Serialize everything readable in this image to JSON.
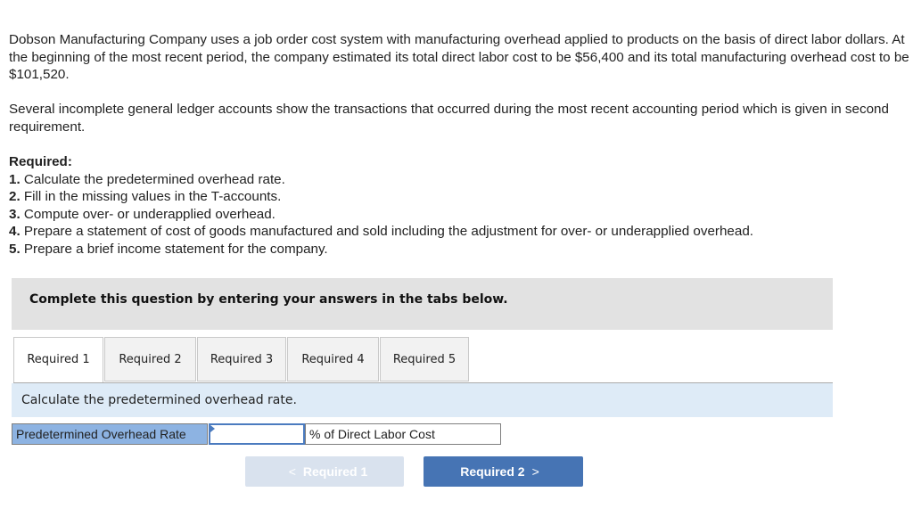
{
  "problem": {
    "paragraph1": "Dobson Manufacturing Company uses a job order cost system with manufacturing overhead applied to products on the basis of direct labor dollars. At the beginning of the most recent period, the company estimated its total direct labor cost to be $56,400 and its total manufacturing overhead cost to be $101,520.",
    "paragraph2": "Several incomplete general ledger accounts show the transactions that occurred during the most recent accounting period which is given in second requirement.",
    "required_heading": "Required:",
    "requirements": [
      {
        "num": "1.",
        "text": " Calculate the predetermined overhead rate."
      },
      {
        "num": "2.",
        "text": " Fill in the missing values in the T-accounts."
      },
      {
        "num": "3.",
        "text": " Compute over- or underapplied overhead."
      },
      {
        "num": "4.",
        "text": " Prepare a statement of cost of goods manufactured and sold including the adjustment for over- or underapplied overhead."
      },
      {
        "num": "5.",
        "text": " Prepare a brief income statement for the company."
      }
    ]
  },
  "banner": {
    "text": "Complete this question by entering your answers in the tabs below."
  },
  "tabs": [
    {
      "label": "Required 1",
      "active": true
    },
    {
      "label": "Required 2",
      "active": false
    },
    {
      "label": "Required 3",
      "active": false
    },
    {
      "label": "Required 4",
      "active": false
    },
    {
      "label": "Required 5",
      "active": false
    }
  ],
  "prompt": {
    "text": "Calculate the predetermined overhead rate."
  },
  "answer_row": {
    "label": "Predetermined Overhead Rate",
    "value": "",
    "unit": "% of Direct Labor Cost"
  },
  "nav": {
    "prev_label": "Required 1",
    "prev_icon": "<",
    "next_label": "Required 2",
    "next_icon": ">"
  },
  "colors": {
    "banner_bg": "#e2e2e2",
    "prompt_bg": "#deebf7",
    "label_cell_bg": "#8db3e2",
    "next_button_bg": "#4674b4",
    "prev_button_bg": "#d9e2ee"
  }
}
